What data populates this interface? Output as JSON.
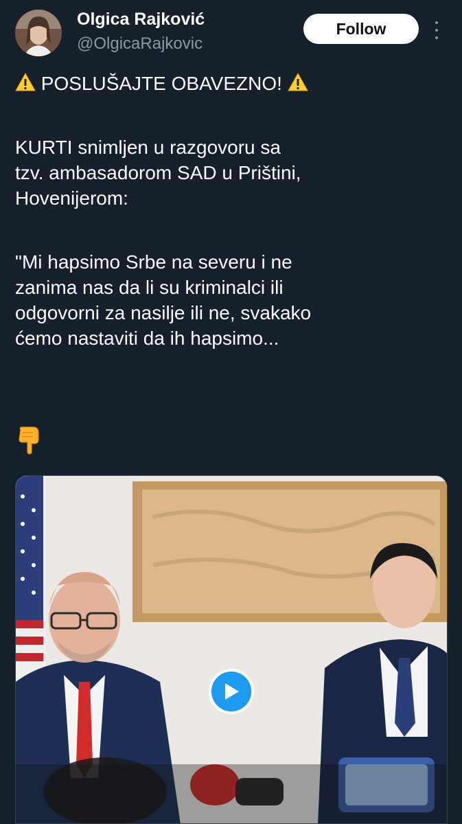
{
  "author": {
    "name": "Olgica Rajković",
    "handle": "@OlgicaRajkovic",
    "follow_label": "Follow"
  },
  "tweet": {
    "headline": "POSLUŠAJTE OBAVEZNO!",
    "paragraph1": [
      "KURTI snimljen u razgovoru sa",
      "tzv. ambasadorom SAD u Prištini,",
      "Hovenijerom:"
    ],
    "paragraph2": [
      "\"Mi hapsimo Srbe na severu i ne",
      "zanima nas da li su kriminalci ili",
      "odgovorni za nasilje ili ne, svakako",
      "ćemo nastaviti da ih hapsimo..."
    ]
  },
  "icons": {
    "warning": "warning-icon",
    "pointing": "pointing-down-icon",
    "play": "play-icon",
    "more": "more-options-icon"
  },
  "colors": {
    "background": "#15202b",
    "accent": "#1d9bf0",
    "secondary_text": "#8b98a5"
  }
}
